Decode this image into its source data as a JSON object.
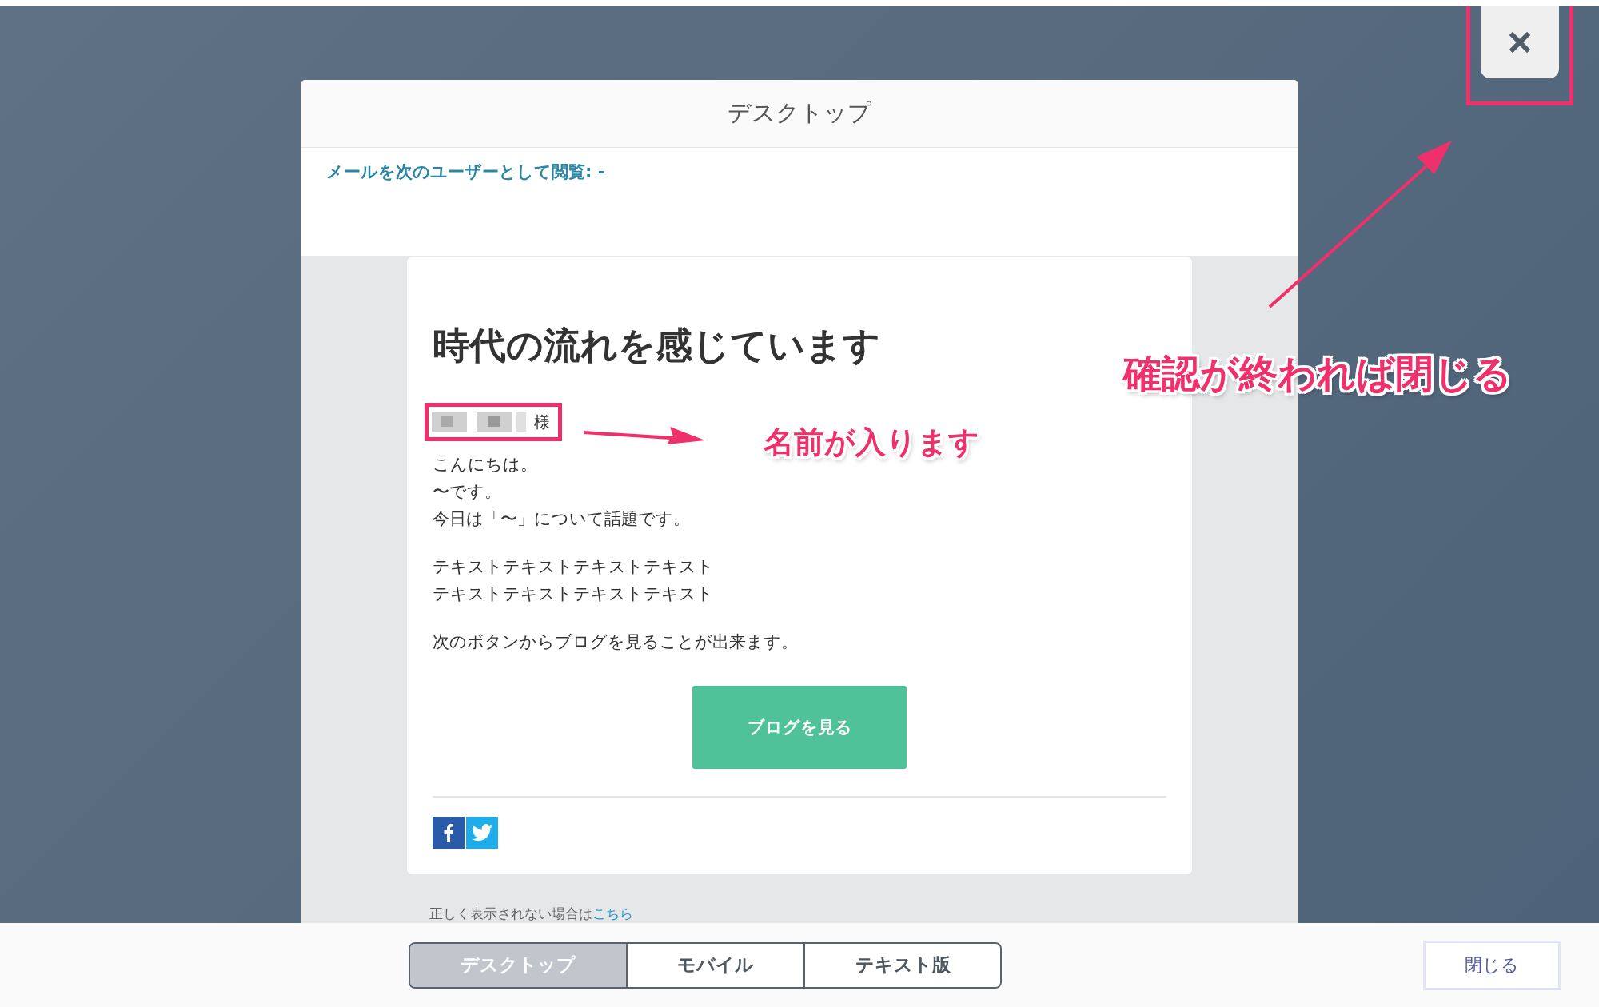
{
  "modal": {
    "title": "デスクトップ",
    "viewer_label": "メールを次のユーザーとして閲覧: -"
  },
  "email": {
    "heading": "時代の流れを感じています",
    "recipient_suffix": "様",
    "paragraphs": [
      [
        "こんにちは。",
        "〜です。",
        "今日は「〜」について話題です。"
      ],
      [
        "テキストテキストテキストテキスト",
        "テキストテキストテキストテキスト"
      ],
      [
        "次のボタンからブログを見ることが出来ます。"
      ]
    ],
    "cta": "ブログを見る",
    "fallback": {
      "text": "正しく表示されない場合は",
      "link": "こちら"
    }
  },
  "view_tabs": [
    {
      "label": "デスクトップ",
      "selected": true
    },
    {
      "label": "モバイル",
      "selected": false
    },
    {
      "label": "テキスト版",
      "selected": false
    }
  ],
  "close_button": "閉じる",
  "annotations": [
    {
      "text": "名前が入ります"
    },
    {
      "text": "確認が終われば閉じる"
    }
  ]
}
